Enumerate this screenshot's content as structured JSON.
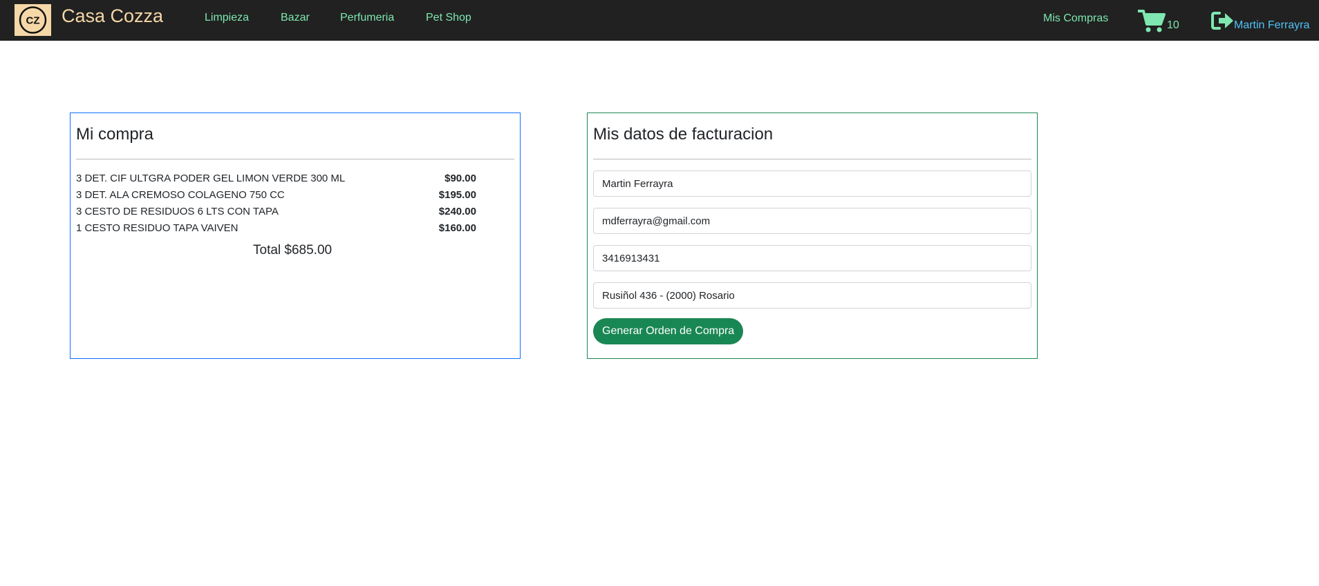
{
  "navbar": {
    "logo_text": "CZ",
    "brand": "Casa Cozza",
    "links": [
      "Limpieza",
      "Bazar",
      "Perfumeria",
      "Pet Shop"
    ],
    "mis_compras": "Mis Compras",
    "cart_count": "10",
    "user_name": "Martin Ferrayra",
    "colors": {
      "bg": "#212121",
      "link": "#7ee8b0",
      "brand": "#f6d7a7",
      "user": "#4fc3f7"
    }
  },
  "purchase": {
    "title": "Mi compra",
    "items": [
      {
        "name": "3 DET. CIF ULTGRA PODER GEL LIMON VERDE 300 ML",
        "price": "$90.00"
      },
      {
        "name": "3 DET. ALA CREMOSO COLAGENO 750 CC",
        "price": "$195.00"
      },
      {
        "name": "3 CESTO DE RESIDUOS 6 LTS CON TAPA",
        "price": "$240.00"
      },
      {
        "name": "1 CESTO RESIDUO TAPA VAIVEN",
        "price": "$160.00"
      }
    ],
    "total": "Total $685.00",
    "border_color": "#0d6efd"
  },
  "billing": {
    "title": "Mis datos de facturacion",
    "name": "Martin Ferrayra",
    "email": "mdferrayra@gmail.com",
    "phone": "3416913431",
    "address": "Rusiñol 436 - (2000) Rosario",
    "submit_label": "Generar Orden de Compra",
    "border_color": "#198754"
  },
  "icons": {
    "cart": "cart-icon",
    "logout": "logout-icon",
    "logo": "logo-icon"
  }
}
